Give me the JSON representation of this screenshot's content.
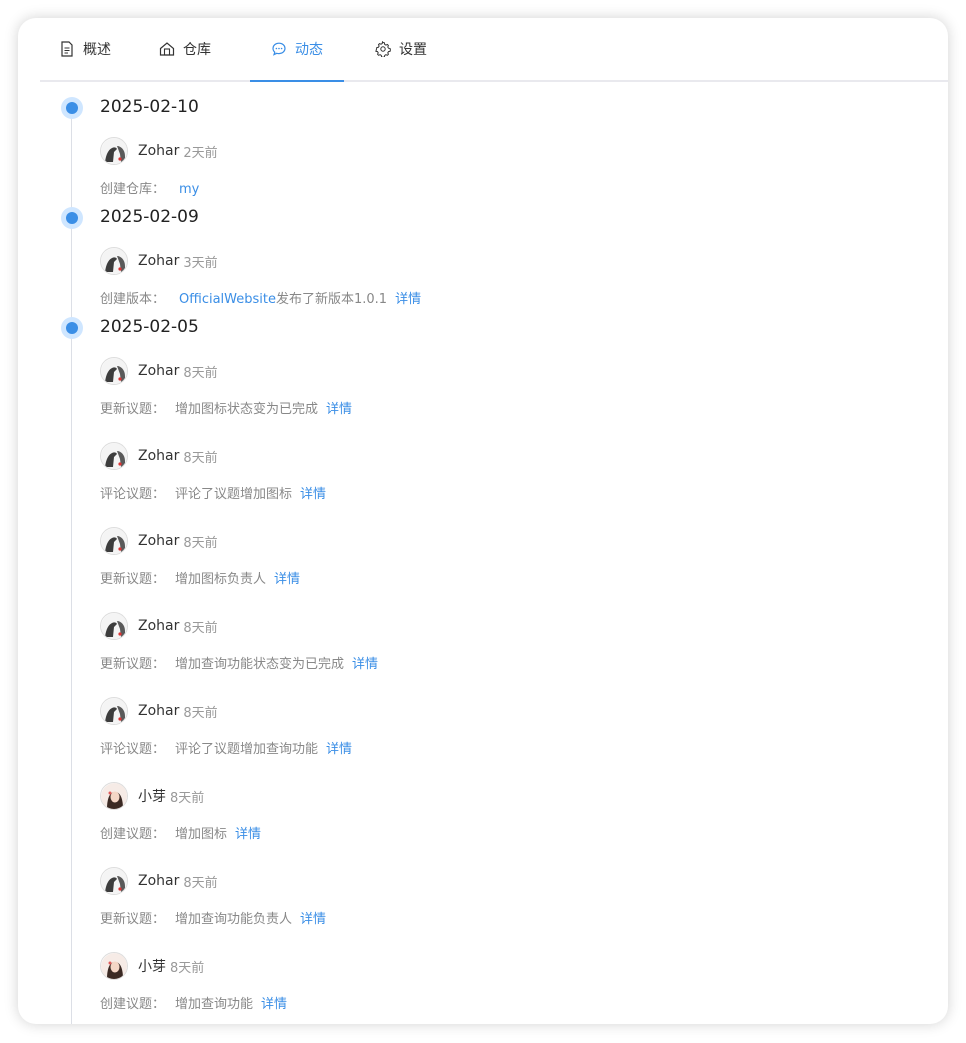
{
  "tabs": [
    {
      "label": "概述",
      "icon": "document-icon",
      "active": false
    },
    {
      "label": "仓库",
      "icon": "repository-icon",
      "active": false
    },
    {
      "label": "动态",
      "icon": "chat-bubble-icon",
      "active": true
    },
    {
      "label": "设置",
      "icon": "gear-icon",
      "active": false
    }
  ],
  "colors": {
    "accent": "#3a8ee6",
    "dot_halo": "#cfe6ff",
    "muted": "#888888"
  },
  "timeline": [
    {
      "date": "2025-02-10",
      "entries": [
        {
          "user": "Zohar",
          "avatar": "zohar-avatar",
          "time": "2天前",
          "action": "创建仓库：",
          "repo": "my"
        }
      ]
    },
    {
      "date": "2025-02-09",
      "entries": [
        {
          "user": "Zohar",
          "avatar": "zohar-avatar",
          "time": "3天前",
          "action": "创建版本：",
          "repo": "OfficialWebsite",
          "text": "发布了新版本1.0.1",
          "link": "详情"
        }
      ]
    },
    {
      "date": "2025-02-05",
      "entries": [
        {
          "user": "Zohar",
          "avatar": "zohar-avatar",
          "time": "8天前",
          "action": "更新议题：",
          "text": "增加图标状态变为已完成",
          "link": "详情"
        },
        {
          "user": "Zohar",
          "avatar": "zohar-avatar",
          "time": "8天前",
          "action": "评论议题：",
          "text": "评论了议题增加图标",
          "link": "详情"
        },
        {
          "user": "Zohar",
          "avatar": "zohar-avatar",
          "time": "8天前",
          "action": "更新议题：",
          "text": "增加图标负责人",
          "link": "详情"
        },
        {
          "user": "Zohar",
          "avatar": "zohar-avatar",
          "time": "8天前",
          "action": "更新议题：",
          "text": "增加查询功能状态变为已完成",
          "link": "详情"
        },
        {
          "user": "Zohar",
          "avatar": "zohar-avatar",
          "time": "8天前",
          "action": "评论议题：",
          "text": "评论了议题增加查询功能",
          "link": "详情"
        },
        {
          "user": "小芽",
          "avatar": "xiaoya-avatar",
          "time": "8天前",
          "action": "创建议题：",
          "text": "增加图标",
          "link": "详情"
        },
        {
          "user": "Zohar",
          "avatar": "zohar-avatar",
          "time": "8天前",
          "action": "更新议题：",
          "text": "增加查询功能负责人",
          "link": "详情"
        },
        {
          "user": "小芽",
          "avatar": "xiaoya-avatar",
          "time": "8天前",
          "action": "创建议题：",
          "text": "增加查询功能",
          "link": "详情"
        }
      ]
    }
  ]
}
